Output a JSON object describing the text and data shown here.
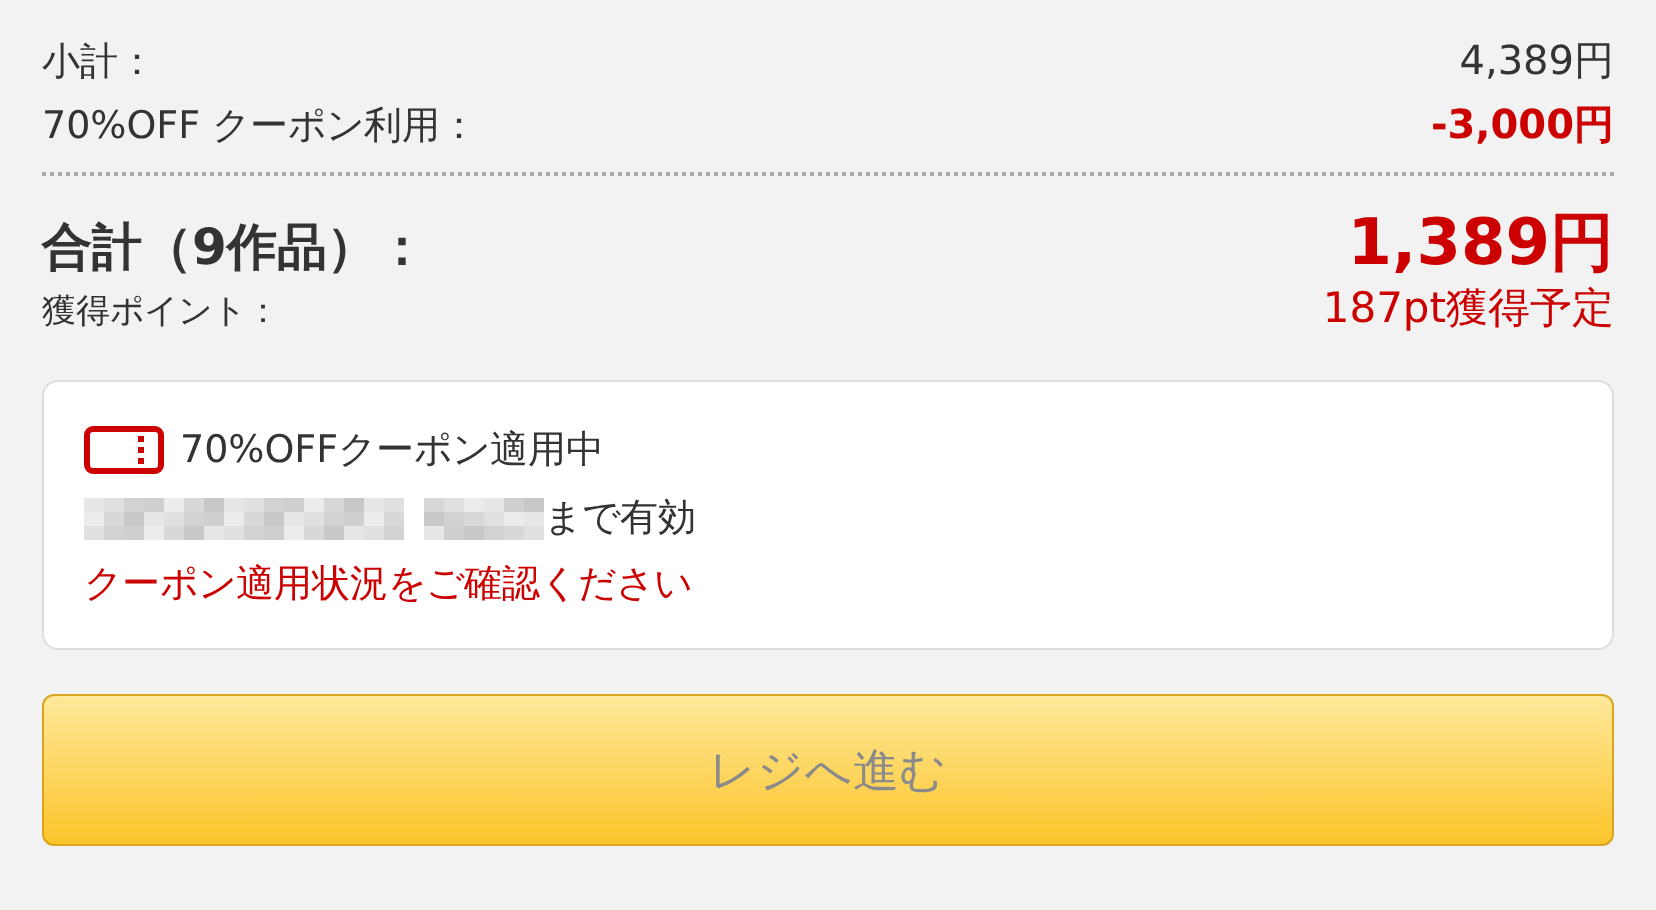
{
  "summary": [
    {
      "label": "小計：",
      "amount": "4,389円",
      "kind": "plain"
    },
    {
      "label": "70%OFF クーポン利用：",
      "amount": "-3,000円",
      "kind": "discount"
    }
  ],
  "total": {
    "label": "合計（9作品）：",
    "amount": "1,389円"
  },
  "points": {
    "label": "獲得ポイント：",
    "value": "187pt獲得予定"
  },
  "coupon": {
    "title": "70%OFFクーポン適用中",
    "validity_suffix": "まで有効",
    "notice": "クーポン適用状況をご確認ください"
  },
  "checkout_button": {
    "label": "レジへ進む",
    "disabled": true
  }
}
